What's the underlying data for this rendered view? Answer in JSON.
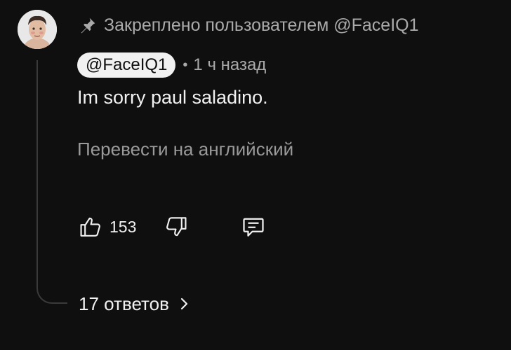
{
  "comment": {
    "pinned_text": "Закреплено пользователем @FaceIQ1",
    "author": "@FaceIQ1",
    "separator": "•",
    "time": "1 ч назад",
    "text": "Im sorry paul saladino.",
    "translate_label": "Перевести на английский",
    "like_count": "153",
    "replies_label": "17 ответов"
  },
  "icons": {
    "pin": "pin-icon",
    "like": "thumb-up-icon",
    "dislike": "thumb-down-icon",
    "reply": "comment-icon",
    "chevron": "chevron-right-icon"
  },
  "colors": {
    "background": "#0f0f0f",
    "primary_text": "#f1f1f1",
    "secondary_text": "#aaaaaa",
    "chip_background": "#f1f1f1"
  }
}
